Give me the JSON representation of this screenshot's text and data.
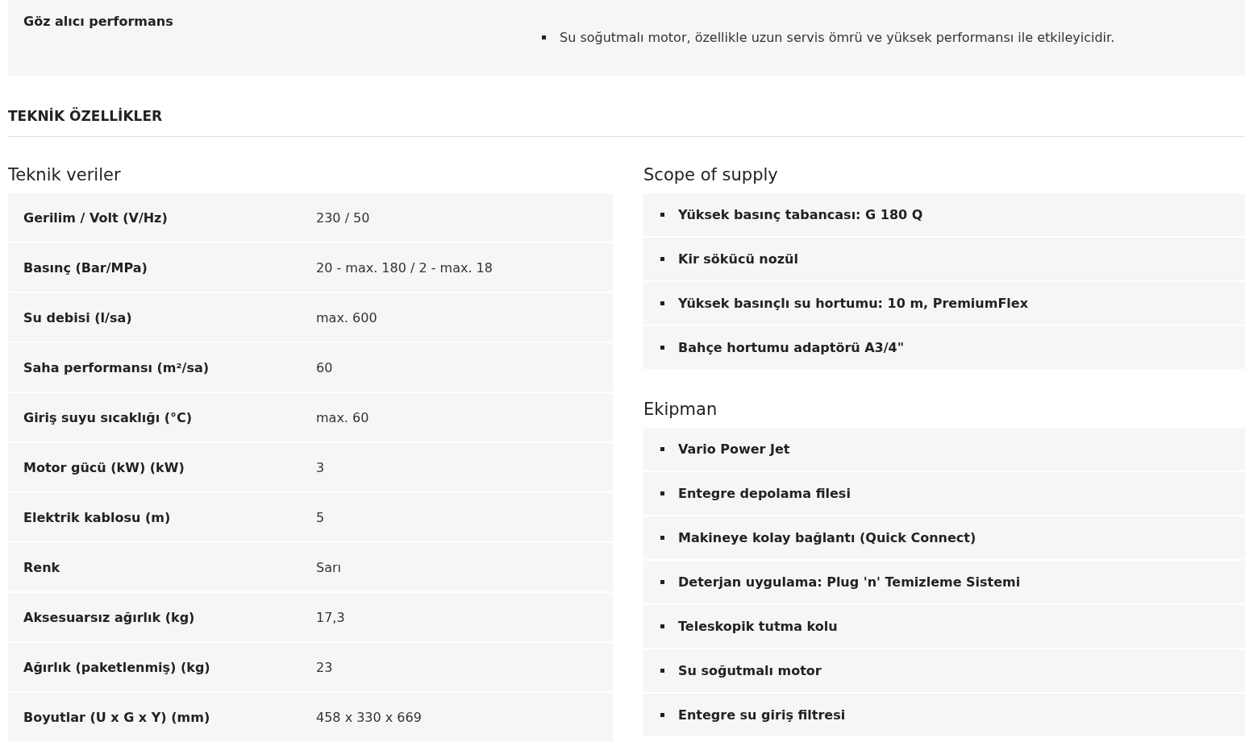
{
  "highlight": {
    "label": "Göz alıcı performans",
    "items": [
      "Su soğutmalı motor, özellikle uzun servis ömrü ve yüksek performansı ile etkileyicidir."
    ]
  },
  "section_title": "TEKNİK ÖZELLİKLER",
  "technical_data": {
    "title": "Teknik veriler",
    "rows": [
      {
        "label": "Gerilim / Volt (V/Hz)",
        "value": "230 / 50"
      },
      {
        "label": "Basınç (Bar/MPa)",
        "value": "20 - max. 180 / 2 - max. 18"
      },
      {
        "label": "Su debisi (l/sa)",
        "value": "max. 600"
      },
      {
        "label": "Saha performansı (m²/sa)",
        "value": "60"
      },
      {
        "label": "Giriş suyu sıcaklığı (°C)",
        "value": "max. 60"
      },
      {
        "label": "Motor gücü (kW) (kW)",
        "value": "3"
      },
      {
        "label": "Elektrik kablosu (m)",
        "value": "5"
      },
      {
        "label": "Renk",
        "value": "Sarı"
      },
      {
        "label": "Aksesuarsız ağırlık (kg)",
        "value": "17,3"
      },
      {
        "label": "Ağırlık (paketlenmiş) (kg)",
        "value": "23"
      },
      {
        "label": "Boyutlar (U x G x Y) (mm)",
        "value": "458 x 330 x 669"
      }
    ]
  },
  "scope_of_supply": {
    "title": "Scope of supply",
    "items": [
      "Yüksek basınç tabancası: G 180 Q",
      "Kir sökücü nozül",
      "Yüksek basınçlı su hortumu: 10 m, PremiumFlex",
      "Bahçe hortumu adaptörü A3/4\""
    ]
  },
  "equipment": {
    "title": "Ekipman",
    "items": [
      "Vario Power Jet",
      "Entegre depolama filesi",
      "Makineye kolay bağlantı (Quick Connect)",
      "Deterjan uygulama: Plug 'n' Temizleme Sistemi",
      "Teleskopik tutma kolu",
      "Su soğutmalı motor",
      "Entegre su giriş filtresi"
    ]
  }
}
